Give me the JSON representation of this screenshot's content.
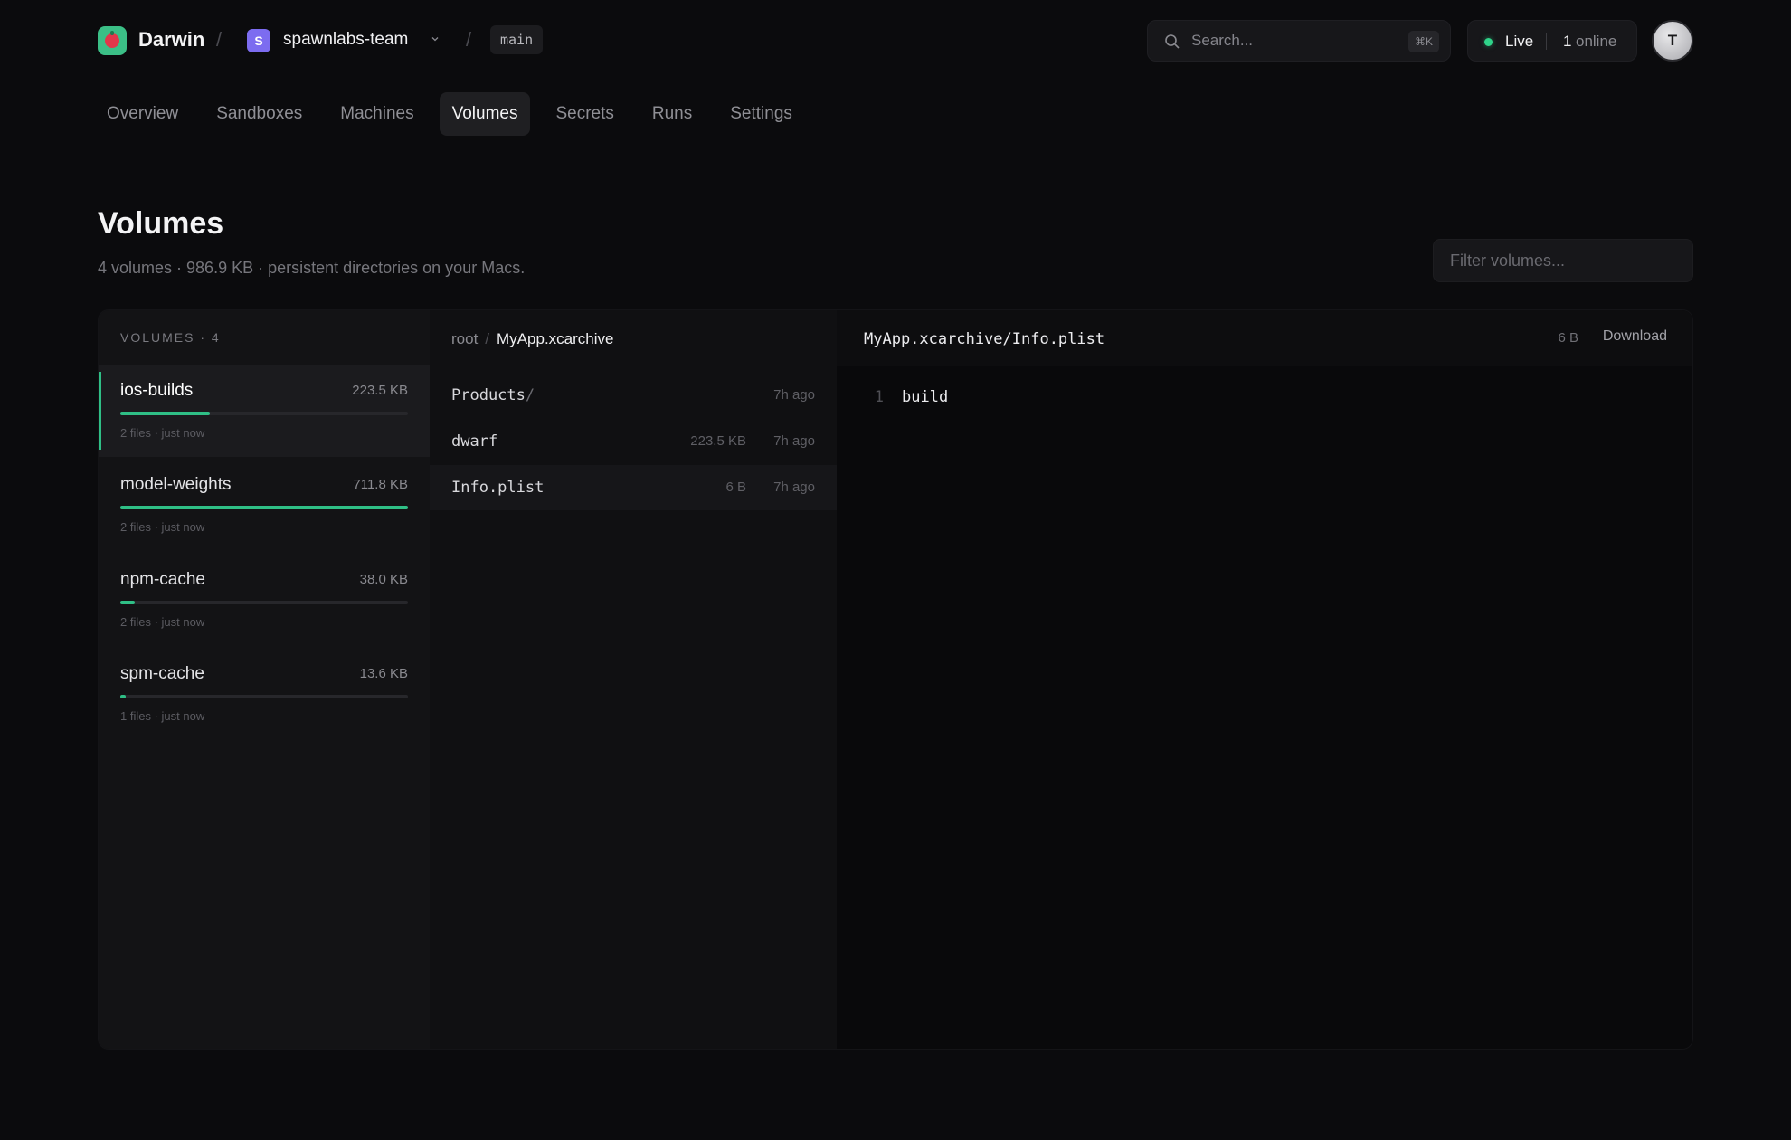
{
  "header": {
    "app_name": "Darwin",
    "separator": "/",
    "team": {
      "badge": "S",
      "name": "spawnlabs-team"
    },
    "branch": "main",
    "search": {
      "placeholder": "Search...",
      "shortcut": "⌘K"
    },
    "status": {
      "label": "Live",
      "online_count": "1",
      "online_label": "online"
    },
    "avatar_initial": "T"
  },
  "nav": {
    "tabs": [
      {
        "label": "Overview"
      },
      {
        "label": "Sandboxes"
      },
      {
        "label": "Machines"
      },
      {
        "label": "Volumes"
      },
      {
        "label": "Secrets"
      },
      {
        "label": "Runs"
      },
      {
        "label": "Settings"
      }
    ],
    "active": "Volumes"
  },
  "page": {
    "title": "Volumes",
    "subtitle": "4 volumes · 986.9 KB · persistent directories on your Macs.",
    "filter_placeholder": "Filter volumes..."
  },
  "volumes": {
    "header": "VOLUMES · 4",
    "items": [
      {
        "name": "ios-builds",
        "size": "223.5 KB",
        "meta": "2 files · just now",
        "usage_fraction": 0.31,
        "active": true
      },
      {
        "name": "model-weights",
        "size": "711.8 KB",
        "meta": "2 files · just now",
        "usage_fraction": 1.0,
        "active": false
      },
      {
        "name": "npm-cache",
        "size": "38.0 KB",
        "meta": "2 files · just now",
        "usage_fraction": 0.05,
        "active": false
      },
      {
        "name": "spm-cache",
        "size": "13.6 KB",
        "meta": "1 files · just now",
        "usage_fraction": 0.02,
        "active": false
      }
    ]
  },
  "browser": {
    "breadcrumb": {
      "root": "root",
      "separator": "/",
      "current": "MyApp.xcarchive"
    },
    "files": [
      {
        "name": "Products",
        "dir_suffix": "/",
        "size": "",
        "modified": "7h ago",
        "selected": false
      },
      {
        "name": "dwarf",
        "dir_suffix": "",
        "size": "223.5 KB",
        "modified": "7h ago",
        "selected": false
      },
      {
        "name": "Info.plist",
        "dir_suffix": "",
        "size": "6 B",
        "modified": "7h ago",
        "selected": true
      }
    ]
  },
  "preview": {
    "path": "MyApp.xcarchive/Info.plist",
    "size": "6 B",
    "download_label": "Download",
    "lines": [
      {
        "no": "1",
        "text": "build"
      }
    ]
  },
  "colors": {
    "accent": "#2fbf86",
    "live": "#2fd389",
    "team_badge": "#7c6cf0"
  }
}
